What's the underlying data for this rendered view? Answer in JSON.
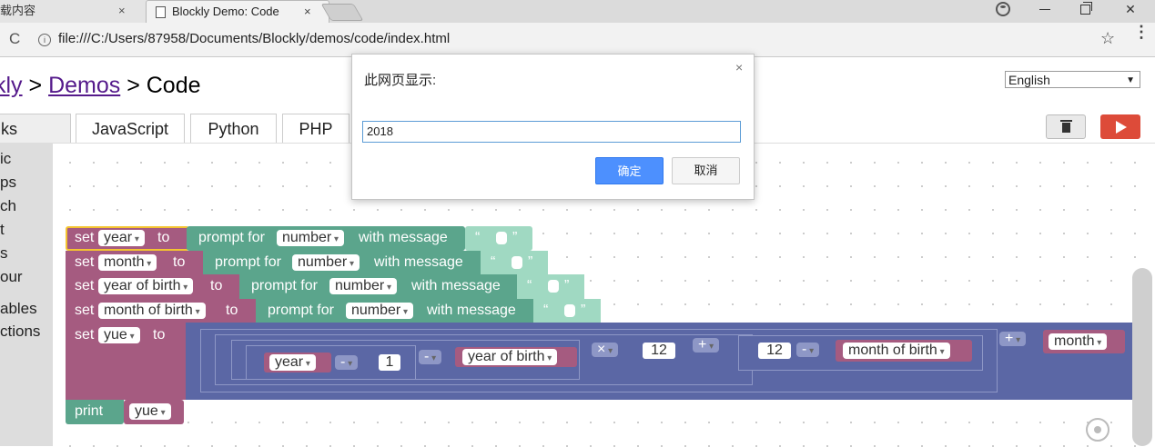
{
  "browser": {
    "tabs": [
      {
        "title": "载内容",
        "close": "×"
      },
      {
        "title": "Blockly Demo: Code",
        "close": "×"
      }
    ],
    "url": "file:///C:/Users/87958/Documents/Blockly/demos/code/index.html",
    "info_glyph": "i",
    "reload_glyph": "C",
    "star_glyph": "☆",
    "menu_glyph": "⋮",
    "close_glyph": "✕"
  },
  "header": {
    "crumb1": "kly",
    "sep1": " > ",
    "crumb2": "Demos",
    "sep2": " > ",
    "current": "Code"
  },
  "language": {
    "selected": "English",
    "arrow": "▼"
  },
  "tabs": {
    "blocks": "ks",
    "javascript": "JavaScript",
    "python": "Python",
    "php": "PHP"
  },
  "toolbox": [
    "ic",
    "ps",
    "ch",
    "t",
    "s",
    "our",
    "ables",
    "ctions"
  ],
  "blocks": {
    "set": "set",
    "to": "to",
    "prompt": "prompt for",
    "number": "number",
    "with_message": "with message",
    "quote_open": "“",
    "quote_close": "”",
    "var_year": "year",
    "var_month": "month",
    "var_yob": "year of birth",
    "var_mob": "month of birth",
    "var_yue": "yue",
    "minus": "-",
    "times": "×",
    "plus": "+",
    "n1": "1",
    "n12a": "12",
    "n12b": "12",
    "print": "print"
  },
  "dialog": {
    "title": "此网页显示:",
    "close": "×",
    "input_value": "2018",
    "ok": "确定",
    "cancel": "取消"
  },
  "colors": {
    "variable_block": "#a55b80",
    "text_block": "#5ba58c",
    "math_block": "#5b67a5",
    "run_button": "#dd4b39",
    "primary_button": "#4d90fe"
  }
}
